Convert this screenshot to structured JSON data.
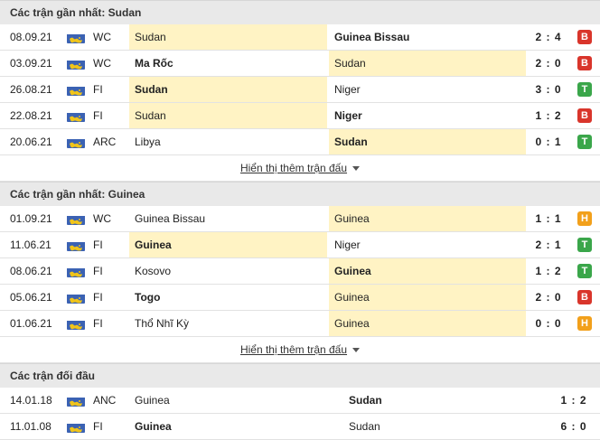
{
  "colors": {
    "loss": "#d9352b",
    "win": "#3aa64a",
    "draw": "#f2a01b",
    "highlight": "#fff3c4",
    "header_bg": "#e9e9e9"
  },
  "flag_icon": "competition-flag-icon",
  "sections": [
    {
      "title": "Các trận gần nhất: Sudan",
      "more_label": "Hiển thị thêm trận đấu",
      "matches": [
        {
          "date": "08.09.21",
          "comp": "WC",
          "home": "Sudan",
          "away": "Guinea Bissau",
          "score": "2 : 4",
          "result": "B",
          "hl": "home",
          "bold": "away"
        },
        {
          "date": "03.09.21",
          "comp": "WC",
          "home": "Ma Rốc",
          "away": "Sudan",
          "score": "2 : 0",
          "result": "B",
          "hl": "away",
          "bold": "home"
        },
        {
          "date": "26.08.21",
          "comp": "FI",
          "home": "Sudan",
          "away": "Niger",
          "score": "3 : 0",
          "result": "T",
          "hl": "home",
          "bold": "home"
        },
        {
          "date": "22.08.21",
          "comp": "FI",
          "home": "Sudan",
          "away": "Niger",
          "score": "1 : 2",
          "result": "B",
          "hl": "home",
          "bold": "away"
        },
        {
          "date": "20.06.21",
          "comp": "ARC",
          "home": "Libya",
          "away": "Sudan",
          "score": "0 : 1",
          "result": "T",
          "hl": "away",
          "bold": "away"
        }
      ]
    },
    {
      "title": "Các trận gần nhất: Guinea",
      "more_label": "Hiển thị thêm trận đấu",
      "matches": [
        {
          "date": "01.09.21",
          "comp": "WC",
          "home": "Guinea Bissau",
          "away": "Guinea",
          "score": "1 : 1",
          "result": "H",
          "hl": "away",
          "bold": ""
        },
        {
          "date": "11.06.21",
          "comp": "FI",
          "home": "Guinea",
          "away": "Niger",
          "score": "2 : 1",
          "result": "T",
          "hl": "home",
          "bold": "home"
        },
        {
          "date": "08.06.21",
          "comp": "FI",
          "home": "Kosovo",
          "away": "Guinea",
          "score": "1 : 2",
          "result": "T",
          "hl": "away",
          "bold": "away"
        },
        {
          "date": "05.06.21",
          "comp": "FI",
          "home": "Togo",
          "away": "Guinea",
          "score": "2 : 0",
          "result": "B",
          "hl": "away",
          "bold": "home"
        },
        {
          "date": "01.06.21",
          "comp": "FI",
          "home": "Thổ Nhĩ Kỳ",
          "away": "Guinea",
          "score": "0 : 0",
          "result": "H",
          "hl": "away",
          "bold": ""
        }
      ]
    }
  ],
  "h2h": {
    "title": "Các trận đối đầu",
    "matches": [
      {
        "date": "14.01.18",
        "comp": "ANC",
        "home": "Guinea",
        "away": "Sudan",
        "score": "1 : 2",
        "bold": "away"
      },
      {
        "date": "11.01.08",
        "comp": "FI",
        "home": "Guinea",
        "away": "Sudan",
        "score": "6 : 0",
        "bold": "home"
      }
    ]
  }
}
